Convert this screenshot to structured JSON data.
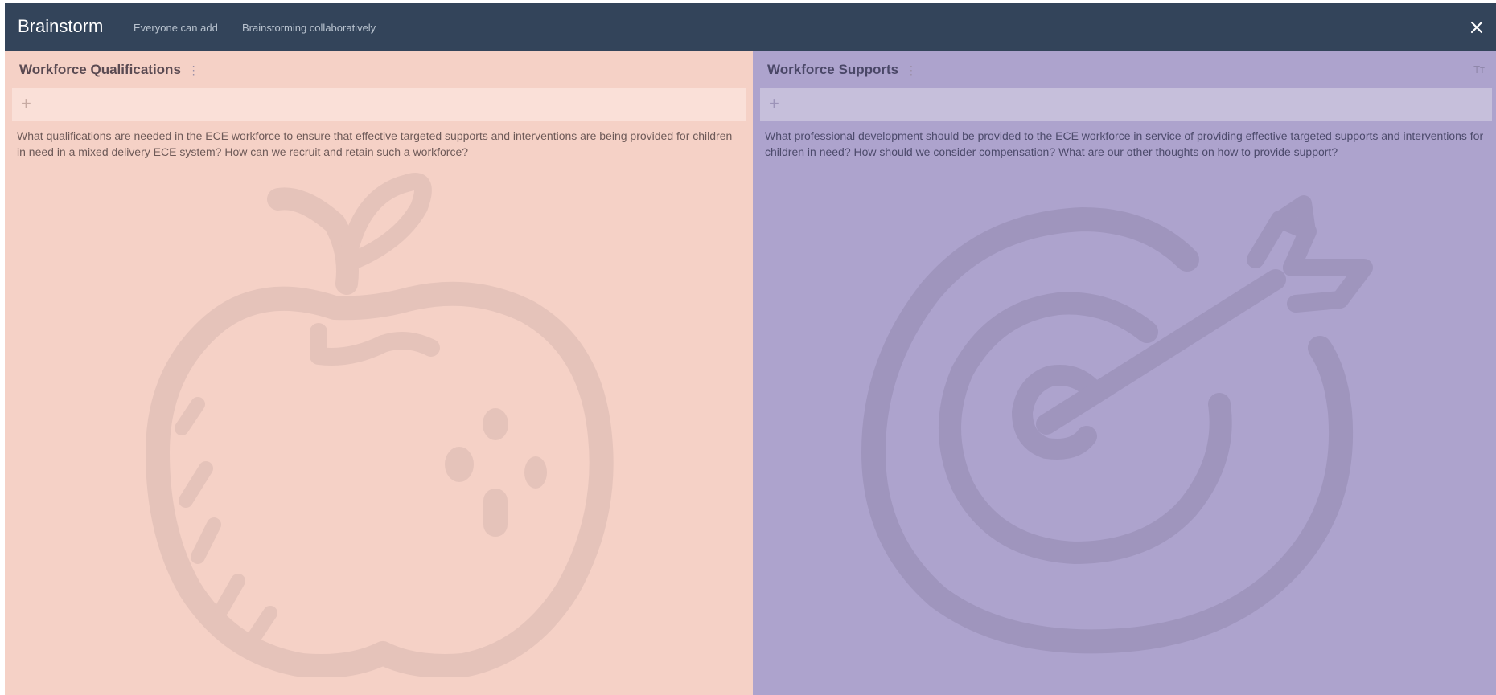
{
  "app": {
    "title": "Brainstorm",
    "permission": "Everyone can add",
    "mode": "Brainstorming collaboratively",
    "close_label": "×"
  },
  "columns": [
    {
      "title": "Workforce Qualifications",
      "menu_icon": "vertical-dots-icon",
      "add_label": "+",
      "description": "What qualifications are needed in the ECE workforce to ensure that effective targeted supports and interventions are being provided for children in need in a mixed delivery ECE system? How can we recruit and retain such a workforce?",
      "background_icon": "apple-icon",
      "color": "#f5d1c6"
    },
    {
      "title": "Workforce Supports",
      "menu_icon": "vertical-dots-icon",
      "add_label": "+",
      "text_size_label": "Tт",
      "description": "What professional development should be provided to the ECE workforce in service of providing effective targeted supports and interventions for children in need? How should we consider compensation? What are our other thoughts on how to provide support?",
      "background_icon": "target-arrow-icon",
      "color": "#ada3cd"
    }
  ],
  "colors": {
    "topbar": "#33445a"
  }
}
